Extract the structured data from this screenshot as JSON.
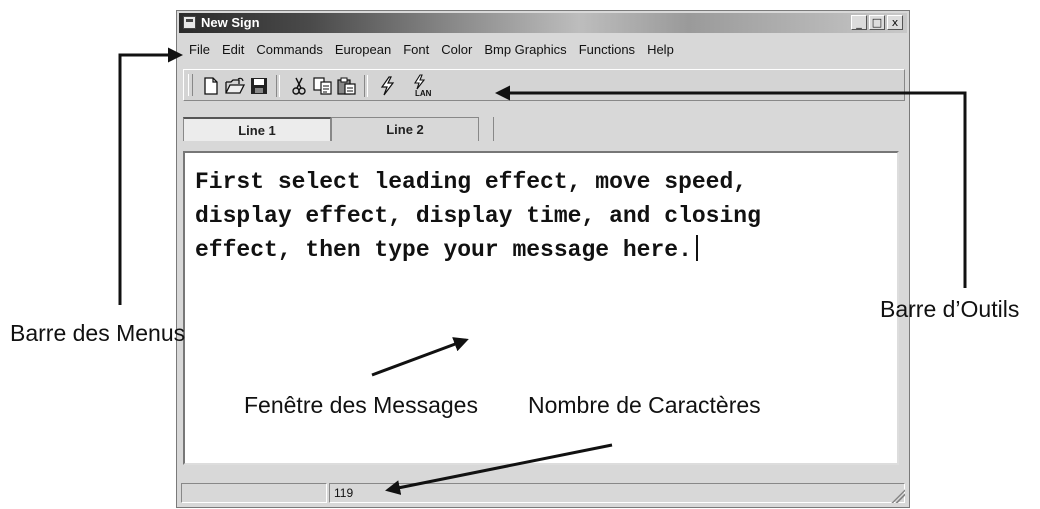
{
  "window": {
    "title": "New Sign",
    "controls": {
      "minimize": "_",
      "maximize": "□",
      "close": "x"
    }
  },
  "menubar": {
    "items": [
      {
        "id": "file",
        "label": "File"
      },
      {
        "id": "edit",
        "label": "Edit"
      },
      {
        "id": "commands",
        "label": "Commands"
      },
      {
        "id": "european",
        "label": "European"
      },
      {
        "id": "font",
        "label": "Font"
      },
      {
        "id": "color",
        "label": "Color"
      },
      {
        "id": "bmp-graphics",
        "label": "Bmp Graphics"
      },
      {
        "id": "functions",
        "label": "Functions"
      },
      {
        "id": "help",
        "label": "Help"
      }
    ]
  },
  "toolbar": {
    "buttons": [
      {
        "id": "new",
        "icon": "new-document-icon"
      },
      {
        "id": "open",
        "icon": "open-folder-icon"
      },
      {
        "id": "save",
        "icon": "save-disk-icon"
      },
      {
        "id": "cut",
        "icon": "scissors-icon"
      },
      {
        "id": "copy",
        "icon": "copy-icon"
      },
      {
        "id": "paste",
        "icon": "paste-icon"
      },
      {
        "id": "send",
        "icon": "lightning-icon"
      },
      {
        "id": "lan",
        "icon": "lan-icon",
        "label": "LAN"
      }
    ]
  },
  "tabs": [
    {
      "id": "line-1",
      "label": "Line 1",
      "active": true
    },
    {
      "id": "line-2",
      "label": "Line 2",
      "active": false
    }
  ],
  "editor": {
    "lines": [
      "First select leading effect, move speed,",
      "display effect, display time, and closing",
      "effect, then type your message here."
    ]
  },
  "statusbar": {
    "char_count": "119"
  },
  "annotations": {
    "menu_bar": "Barre des Menus",
    "toolbar": "Barre d’Outils",
    "message_window": "Fenêtre des Messages",
    "char_count": "Nombre de Caractères"
  }
}
